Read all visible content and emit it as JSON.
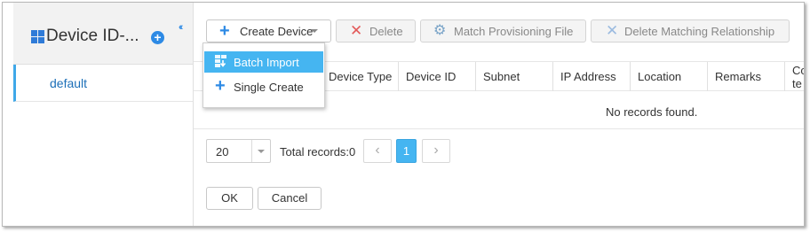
{
  "sidebar": {
    "title": "Device ID-...",
    "add_icon": "plus-circle-icon",
    "collapse_icon": "double-chevron-left-icon",
    "items": [
      {
        "label": "default",
        "selected": true
      }
    ]
  },
  "toolbar": {
    "create_label": "Create Device",
    "delete_label": "Delete",
    "match_label": "Match Provisioning File",
    "delete_matching_label": "Delete Matching Relationship"
  },
  "create_menu": {
    "items": [
      {
        "label": "Batch Import",
        "icon": "batch-import-icon",
        "highlighted": true
      },
      {
        "label": "Single Create",
        "icon": "plus-icon",
        "highlighted": false
      }
    ]
  },
  "table": {
    "columns": [
      "Device Type",
      "Device ID",
      "Subnet",
      "IP Address",
      "Location",
      "Remarks",
      "Co\nte"
    ],
    "empty_text": "No records found."
  },
  "pagination": {
    "page_size": "20",
    "total_label": "Total records:0",
    "current_page": "1",
    "prev_icon": "chevron-left-icon",
    "next_icon": "chevron-right-icon"
  },
  "footer": {
    "ok_label": "OK",
    "cancel_label": "Cancel"
  },
  "colors": {
    "accent": "#45b5f1",
    "primary_blue": "#2d8ae5",
    "delete_red": "#e35a5a"
  }
}
